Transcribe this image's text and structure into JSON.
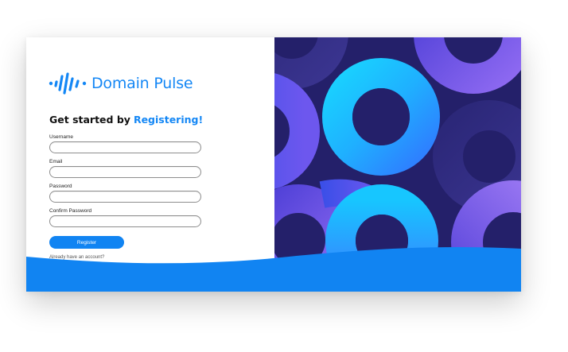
{
  "brand": {
    "name": "Domain Pulse",
    "icon": "pulse-waveform-icon",
    "color": "#1487f5"
  },
  "heading": {
    "prefix": "Get started by",
    "accent": "Registering!"
  },
  "form": {
    "fields": [
      {
        "label": "Username",
        "value": "",
        "placeholder": ""
      },
      {
        "label": "Email",
        "value": "",
        "placeholder": ""
      },
      {
        "label": "Password",
        "value": "",
        "placeholder": ""
      },
      {
        "label": "Confirm Password",
        "value": "",
        "placeholder": ""
      }
    ],
    "submit_label": "Register",
    "account_link": "Already have an account?"
  },
  "colors": {
    "primary": "#1184f2",
    "art_background": "#24206a",
    "art_cyan": "#16c0ff",
    "art_violet": "#7c5cf0"
  }
}
